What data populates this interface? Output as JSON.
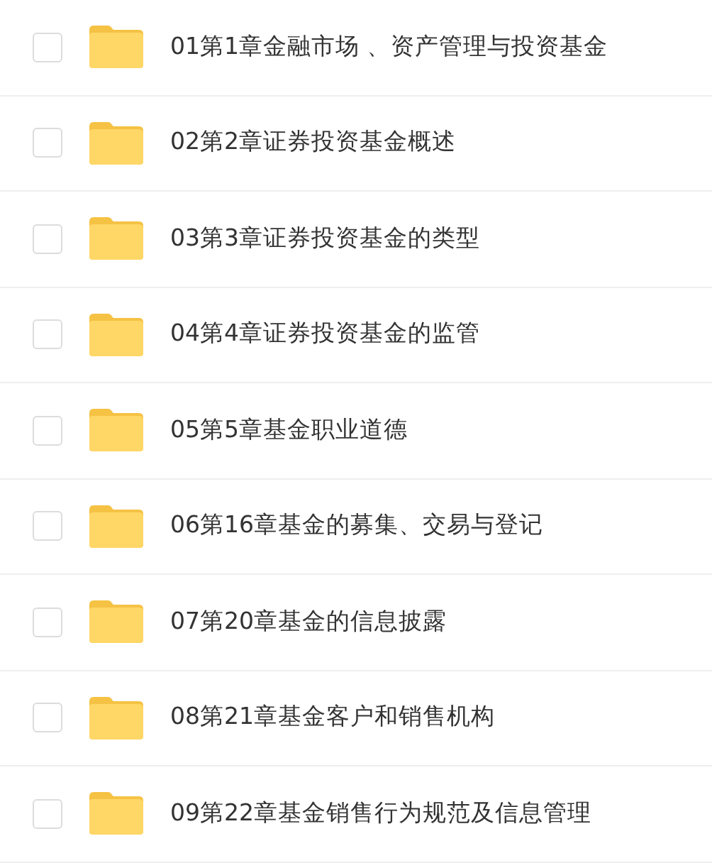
{
  "files": [
    {
      "name": "01第1章金融市场 、资产管理与投资基金",
      "checked": false
    },
    {
      "name": "02第2章证券投资基金概述",
      "checked": false
    },
    {
      "name": "03第3章证券投资基金的类型",
      "checked": false
    },
    {
      "name": "04第4章证券投资基金的监管",
      "checked": false
    },
    {
      "name": "05第5章基金职业道德",
      "checked": false
    },
    {
      "name": "06第16章基金的募集、交易与登记",
      "checked": false
    },
    {
      "name": "07第20章基金的信息披露",
      "checked": false
    },
    {
      "name": "08第21章基金客户和销售机构",
      "checked": false
    },
    {
      "name": "09第22章基金销售行为规范及信息管理",
      "checked": false
    }
  ]
}
